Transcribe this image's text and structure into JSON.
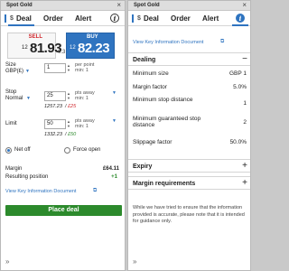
{
  "left": {
    "title": "Spot Gold",
    "close": "×",
    "tabs": {
      "currency": "$",
      "deal": "Deal",
      "order": "Order",
      "alert": "Alert",
      "info": "i"
    },
    "sell": {
      "label": "SELL",
      "small": "12",
      "big": "81.93"
    },
    "buy": {
      "label": "BUY",
      "small": "12",
      "big": "82.23"
    },
    "spread": "0.3",
    "size": {
      "label": "Size",
      "sub": "GBP(£)",
      "value": "1",
      "unit": "per point",
      "min": "min: 1"
    },
    "stop": {
      "label": "Stop",
      "mode": "Normal",
      "value": "25",
      "unit": "pts away",
      "min": "min: 1",
      "level": "1257.23",
      "risk": "£25"
    },
    "limit": {
      "label": "Limit",
      "value": "50",
      "unit": "pts away",
      "min": "min: 1",
      "level": "1332.23",
      "reward": "£50"
    },
    "netoff": "Net off",
    "forceopen": "Force open",
    "margin": {
      "label": "Margin",
      "value": "£64.11"
    },
    "resulting": {
      "label": "Resulting position",
      "value": "+1"
    },
    "kid_link": "View Key Information Document",
    "place_deal": "Place deal",
    "expand": "»"
  },
  "right": {
    "title": "Spot Gold",
    "close": "×",
    "tabs": {
      "currency": "$",
      "deal": "Deal",
      "order": "Order",
      "alert": "Alert",
      "info": "i"
    },
    "kid_link": "View Key Information Document",
    "dealing": {
      "title": "Dealing",
      "toggle": "−",
      "rows": [
        {
          "k": "Minimum size",
          "v": "GBP 1"
        },
        {
          "k": "Margin factor",
          "v": "5.0%"
        },
        {
          "k": "Minimum stop distance",
          "v": "1"
        },
        {
          "k": "Minimum guaranteed stop distance",
          "v": "2"
        },
        {
          "k": "Slippage factor",
          "v": "50.0%"
        }
      ]
    },
    "expiry": {
      "title": "Expiry",
      "toggle": "+"
    },
    "margin_req": {
      "title": "Margin requirements",
      "toggle": "+"
    },
    "note": "While we have tried to ensure that the information provided is accurate, please note that it is intended for guidance only.",
    "expand": "»"
  },
  "colors": {
    "accent": "#2f74c0",
    "sell": "#d0282e",
    "place": "#2c8a2c"
  }
}
